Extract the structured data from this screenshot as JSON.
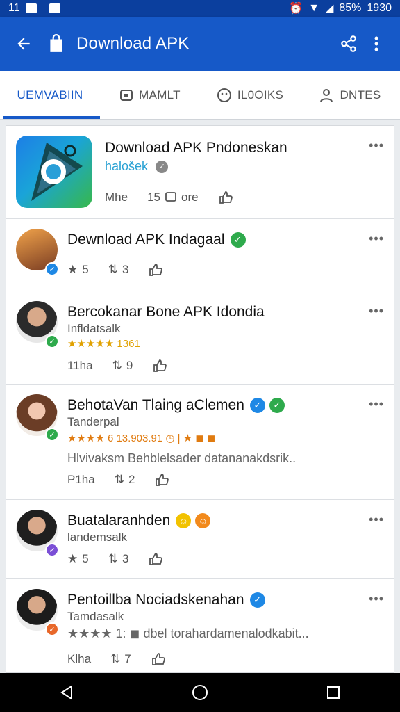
{
  "status_bar": {
    "time": "11",
    "battery": "85%",
    "clock": "1930"
  },
  "app_bar": {
    "title": "Download APK"
  },
  "tabs": [
    {
      "label": "UEMVABIIN",
      "active": true
    },
    {
      "label": "MAMLT",
      "active": false
    },
    {
      "label": "IL0OIKS",
      "active": false
    },
    {
      "label": "DNTES",
      "active": false
    }
  ],
  "featured": {
    "name": "Download APK Pndoneskan",
    "sub": "halošek",
    "action1": "Mhe",
    "action2_count": "15",
    "action2_label": "ore"
  },
  "items": [
    {
      "name": "Dewnload APK Indagaal",
      "sub": "",
      "rating": "",
      "desc": "",
      "stars": "5",
      "shares": "3",
      "badge_color": "#1e88e5",
      "check_color": "#2eaa4c"
    },
    {
      "name": "Bercokanar Bone APK Idondia",
      "sub": "Infldatsalk",
      "rating": "★★★★★ 1361",
      "desc": "",
      "stars": "11ha",
      "shares": "9",
      "badge_color": "#2eaa4c"
    },
    {
      "name": "BehotaVan Tlaing aClemen",
      "sub": "Tanderpal",
      "rating": "★★★★ 6 13.903.91 ◷ | ★ ◼ ◼",
      "desc": "Hlvivaksm Behblelsader datananakdsrik..",
      "stars": "P1ha",
      "shares": "2",
      "badge_color": "#2eaa4c"
    },
    {
      "name": "Buatalaranhden",
      "sub": "landemsalk",
      "rating": "",
      "desc": "",
      "stars": "5",
      "shares": "3",
      "badge_color": "#7b4fd6"
    },
    {
      "name": "Pentoillba Nociadskenahan",
      "sub": "Tamdasalk",
      "rating": "",
      "desc": "★★★★ 1: ◼ dbel torahardamenalodkabit...",
      "stars": "Klha",
      "shares": "7",
      "badge_color": "#e8682a"
    }
  ]
}
